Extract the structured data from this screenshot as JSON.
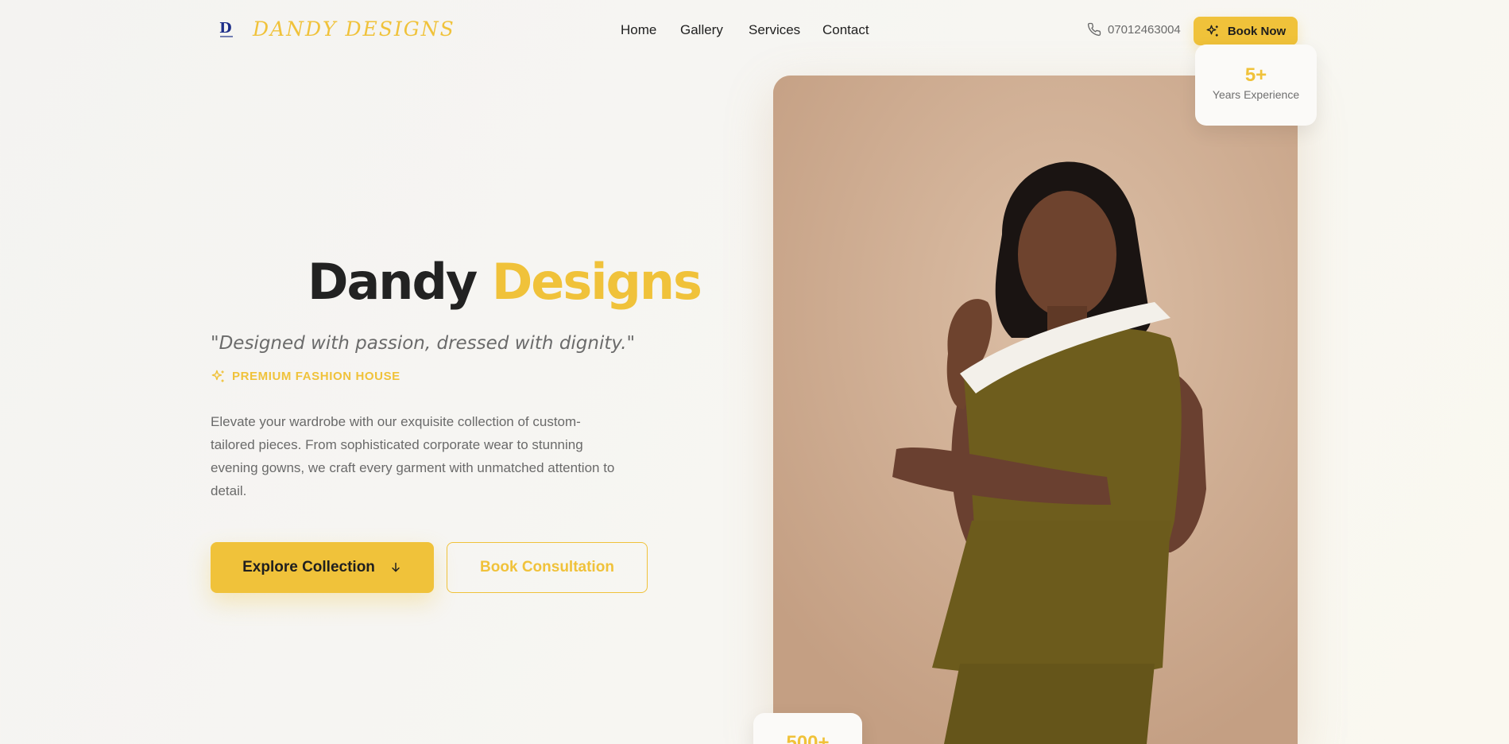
{
  "brand": {
    "name": "DANDY DESIGNS",
    "accent_color": "#f0c23a",
    "logo_icon": "dd-monogram-icon"
  },
  "nav": {
    "items": [
      {
        "label": "Home"
      },
      {
        "label": "Gallery"
      },
      {
        "label": "Services"
      },
      {
        "label": "Contact"
      }
    ]
  },
  "header": {
    "phone": "07012463004",
    "phone_icon": "phone-icon",
    "book_now_label": "Book Now",
    "book_now_icon": "sparkles-icon"
  },
  "hero": {
    "title_part1": "Dandy",
    "title_part2": "Designs",
    "tagline": "\"Designed with passion, dressed with dignity.\"",
    "badge": "PREMIUM FASHION HOUSE",
    "badge_icon": "sparkles-icon",
    "description": "Elevate your wardrobe with our exquisite collection of custom-tailored pieces. From sophisticated corporate wear to stunning evening gowns, we craft every garment with unmatched attention to detail.",
    "primary_button": "Explore Collection",
    "primary_button_icon": "arrow-down-icon",
    "secondary_button": "Book Consultation"
  },
  "stats": {
    "top": {
      "value": "5+",
      "label": "Years Experience"
    },
    "bottom": {
      "value": "500+"
    }
  }
}
